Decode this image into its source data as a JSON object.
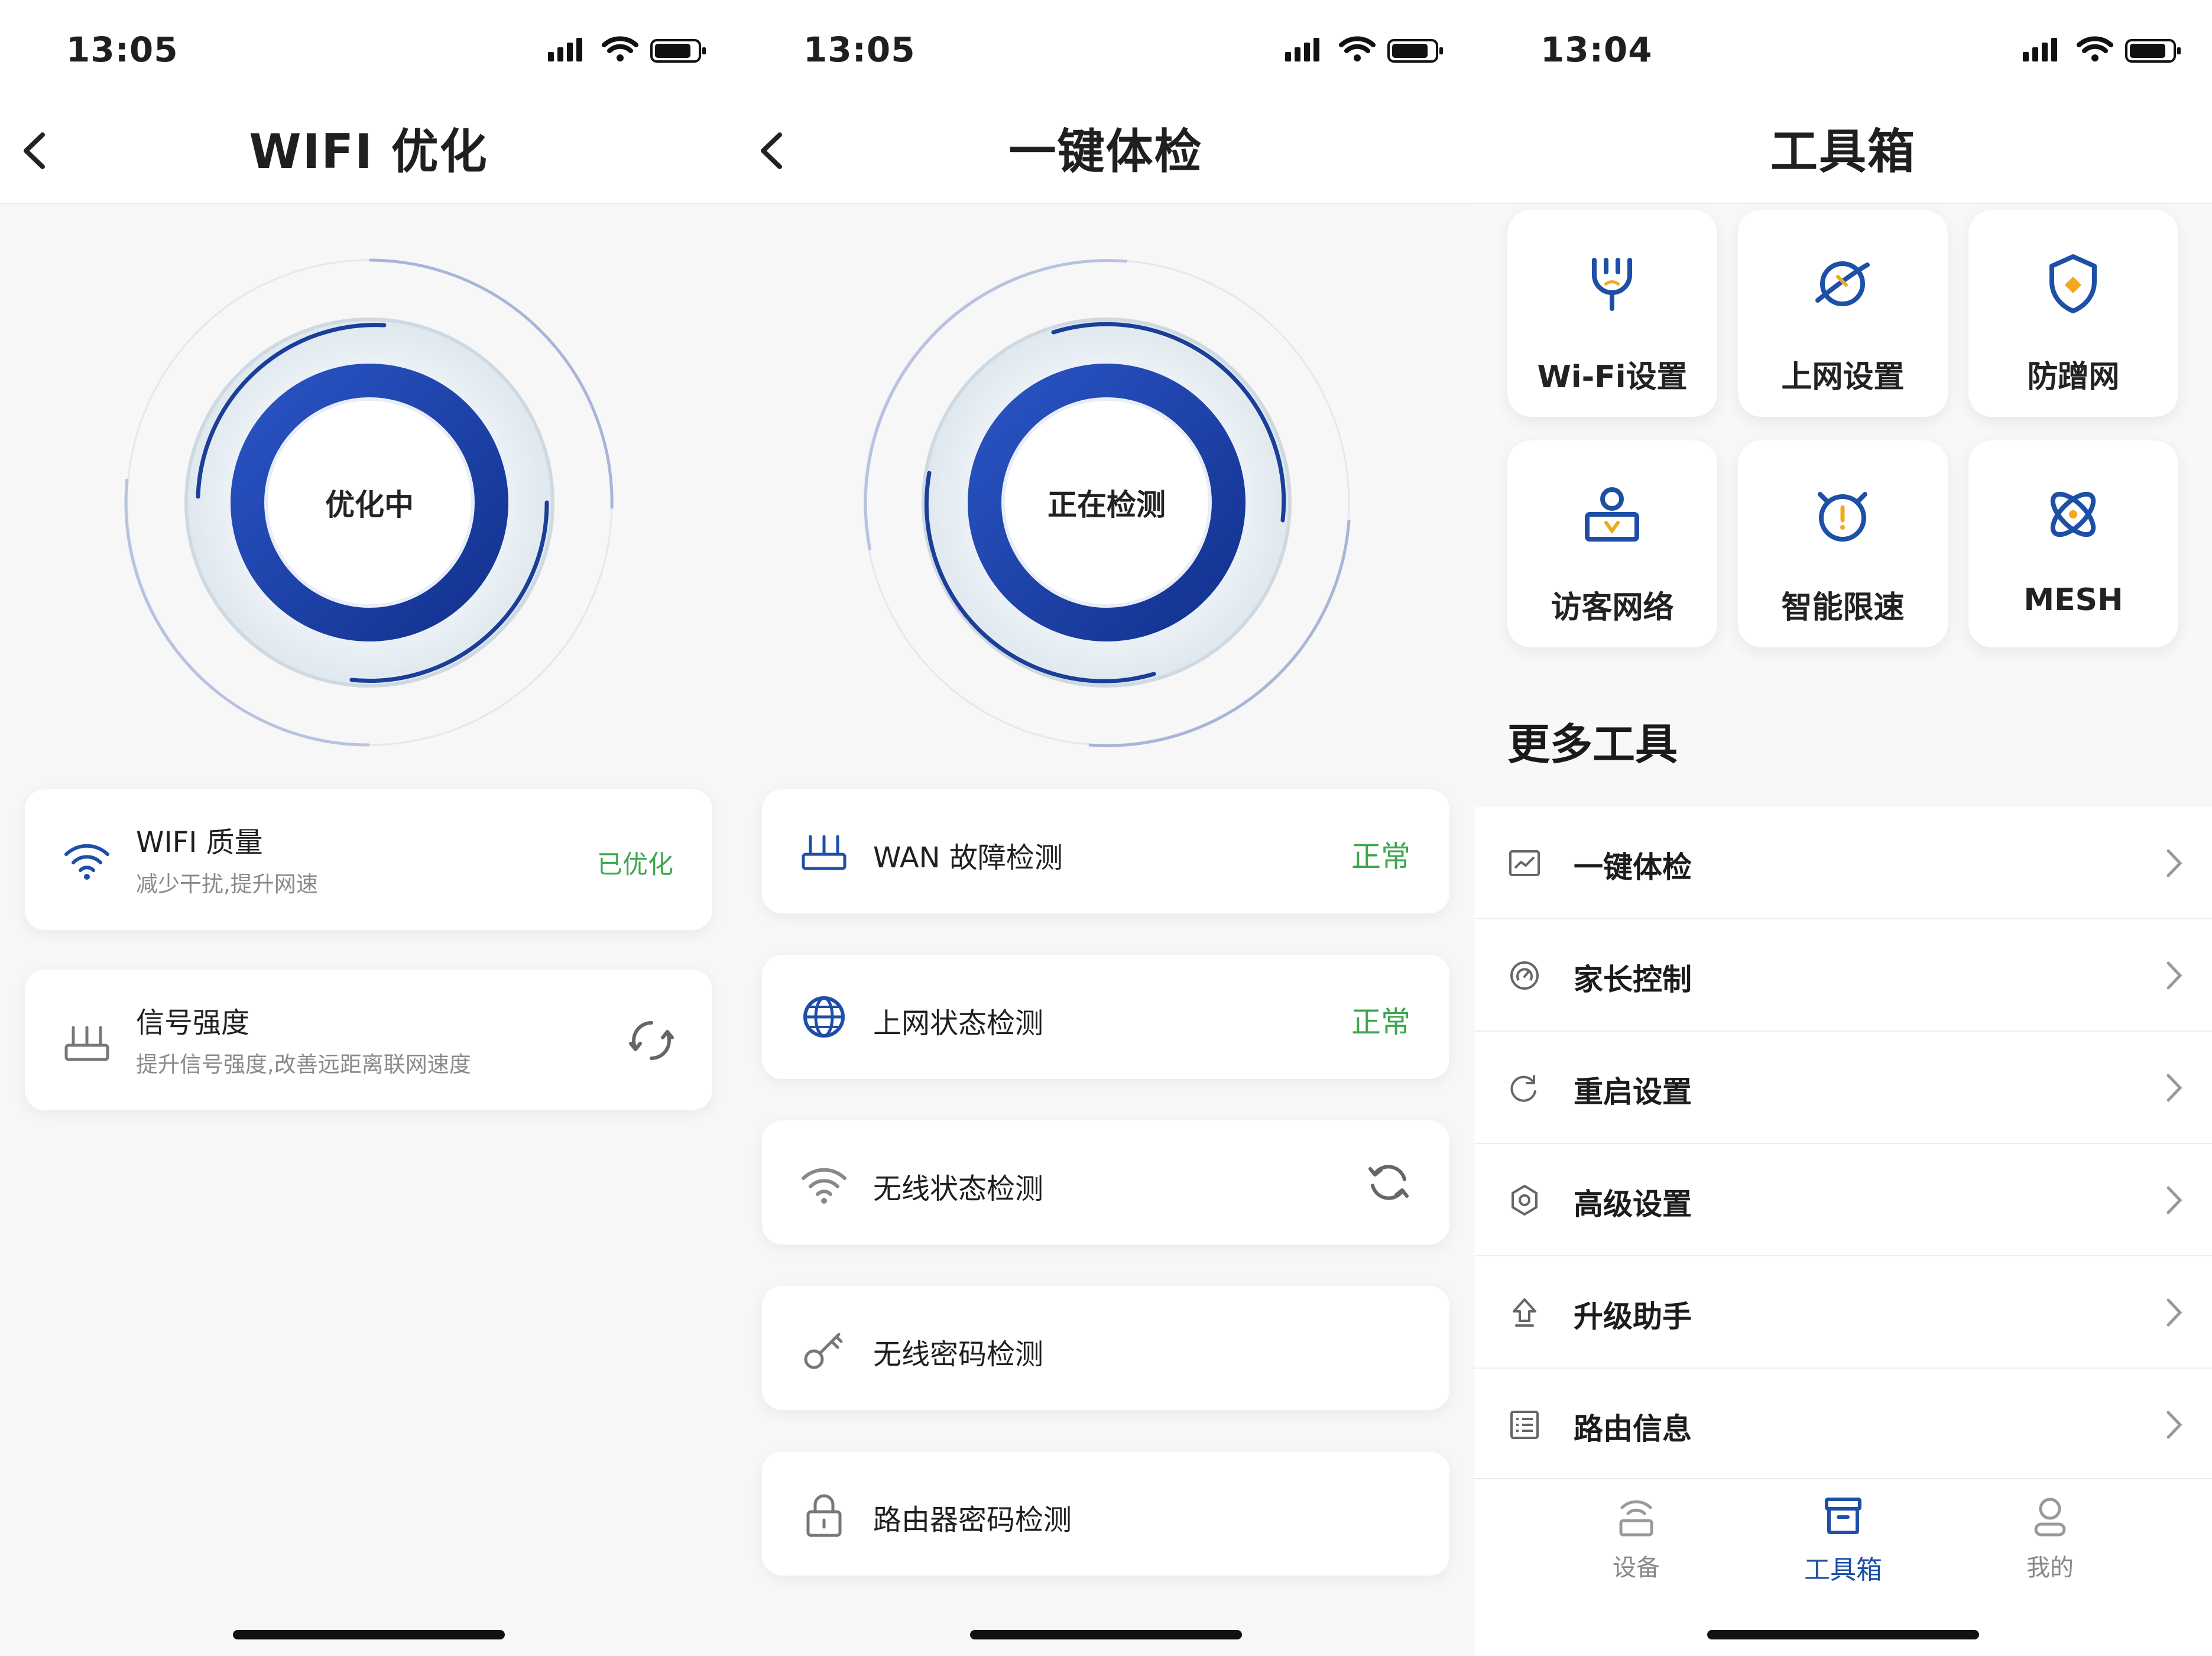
{
  "colors": {
    "accent": "#1d4fa6",
    "ring_blue": "#1c3f9e",
    "status_green": "#3ea64f",
    "text": "#1f1f1f",
    "subtext": "#8a8a8a"
  },
  "screens": {
    "wifi_opt": {
      "status_time": "13:05",
      "title": "WIFI 优化",
      "ring_label": "优化中",
      "cards": [
        {
          "title": "WIFI 质量",
          "subtitle": "减少干扰,提升网速",
          "status": "已优化",
          "icon": "wifi-icon"
        },
        {
          "title": "信号强度",
          "subtitle": "提升信号强度,改善远距离联网速度",
          "status": "",
          "icon": "router-icon"
        }
      ]
    },
    "checkup": {
      "status_time": "13:05",
      "title": "一键体检",
      "ring_label": "正在检测",
      "items": [
        {
          "label": "WAN 故障检测",
          "status": "正常",
          "icon": "router-icon"
        },
        {
          "label": "上网状态检测",
          "status": "正常",
          "icon": "globe-icon"
        },
        {
          "label": "无线状态检测",
          "status": "",
          "icon": "wifi-icon"
        },
        {
          "label": "无线密码检测",
          "status": "",
          "icon": "key-icon"
        },
        {
          "label": "路由器密码检测",
          "status": "",
          "icon": "lock-icon"
        }
      ]
    },
    "toolbox": {
      "status_time": "13:04",
      "title": "工具箱",
      "tiles": [
        {
          "label": "Wi-Fi设置",
          "icon": "wifi-plug-icon"
        },
        {
          "label": "上网设置",
          "icon": "planet-icon"
        },
        {
          "label": "防蹭网",
          "icon": "shield-icon"
        },
        {
          "label": "访客网络",
          "icon": "guest-icon"
        },
        {
          "label": "智能限速",
          "icon": "alarm-icon"
        },
        {
          "label": "MESH",
          "icon": "mesh-icon"
        }
      ],
      "more_title": "更多工具",
      "list": [
        {
          "label": "一键体检",
          "icon": "chart-icon"
        },
        {
          "label": "家长控制",
          "icon": "gauge-icon"
        },
        {
          "label": "重启设置",
          "icon": "restart-icon"
        },
        {
          "label": "高级设置",
          "icon": "gear-icon"
        },
        {
          "label": "升级助手",
          "icon": "upgrade-icon"
        },
        {
          "label": "路由信息",
          "icon": "info-list-icon"
        }
      ],
      "tabs": [
        {
          "label": "设备",
          "icon": "device-icon",
          "active": false
        },
        {
          "label": "工具箱",
          "icon": "toolbox-icon",
          "active": true
        },
        {
          "label": "我的",
          "icon": "profile-icon",
          "active": false
        }
      ]
    }
  }
}
